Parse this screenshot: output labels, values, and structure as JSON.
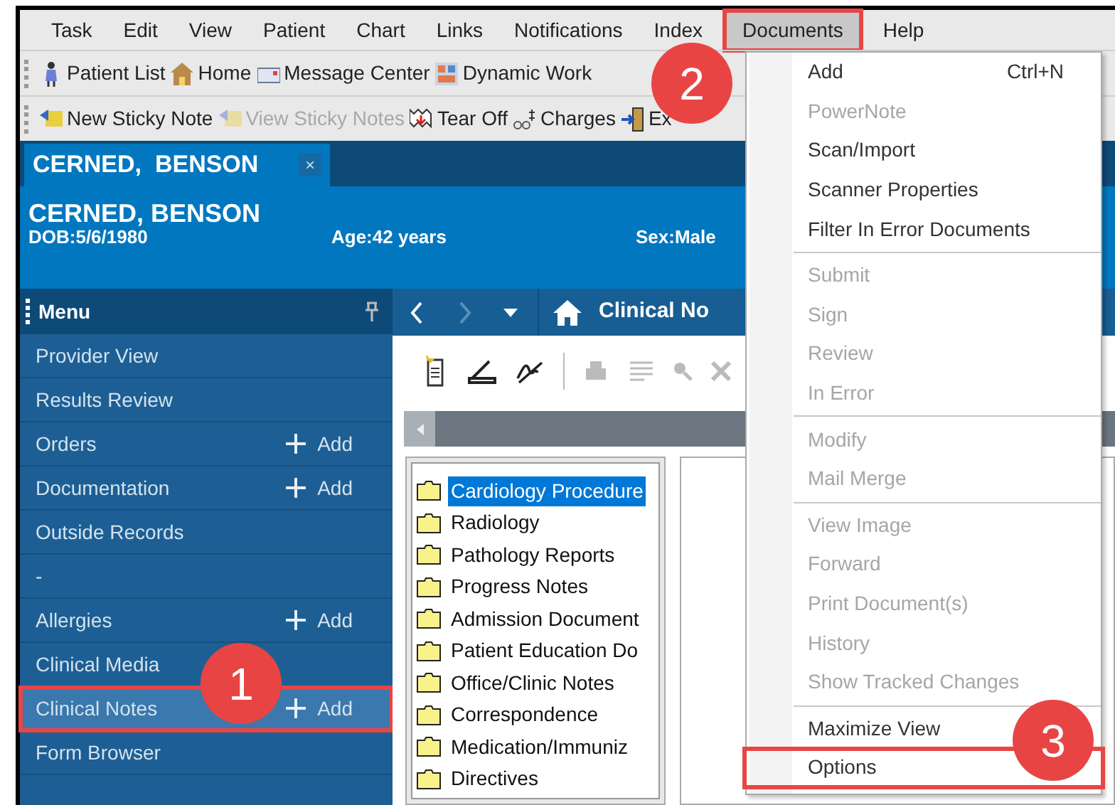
{
  "menu_bar": [
    {
      "label": "Task",
      "selected": false
    },
    {
      "label": "Edit",
      "selected": false
    },
    {
      "label": "View",
      "selected": false
    },
    {
      "label": "Patient",
      "selected": false
    },
    {
      "label": "Chart",
      "selected": false
    },
    {
      "label": "Links",
      "selected": false
    },
    {
      "label": "Notifications",
      "selected": false
    },
    {
      "label": "Index",
      "selected": false
    },
    {
      "label": "Documents",
      "selected": true
    },
    {
      "label": "Help",
      "selected": false
    }
  ],
  "toolbar_1": [
    {
      "label": "Patient List",
      "disabled": false
    },
    {
      "label": "Home",
      "disabled": false
    },
    {
      "label": "Message Center",
      "disabled": false
    },
    {
      "label": "Dynamic Work",
      "disabled": false
    }
  ],
  "toolbar_2": [
    {
      "label": "New Sticky Note",
      "disabled": false
    },
    {
      "label": "View Sticky Notes",
      "disabled": true
    },
    {
      "label": "Tear Off",
      "disabled": false
    },
    {
      "label": "Charges",
      "disabled": false
    },
    {
      "label": "Ex",
      "disabled": false
    }
  ],
  "patient_tab": {
    "label": "CERNED,  BENSON",
    "close": "×"
  },
  "banner": {
    "name": "CERNED, BENSON",
    "dob": "DOB:5/6/1980",
    "age": "Age:42 years",
    "sex": "Sex:Male"
  },
  "sidebar": {
    "title": "Menu",
    "items": [
      {
        "label": "Provider View",
        "selected": false
      },
      {
        "label": "Results Review",
        "selected": false
      },
      {
        "label": "Orders",
        "add": "Add",
        "selected": false
      },
      {
        "label": "Documentation",
        "add": "Add",
        "selected": false
      },
      {
        "label": "Outside Records",
        "selected": false
      },
      {
        "label": "-",
        "selected": false
      },
      {
        "label": "Allergies",
        "add": "Add",
        "selected": false
      },
      {
        "label": "Clinical Media",
        "selected": false
      },
      {
        "label": "Clinical Notes",
        "add": "Add",
        "selected": true
      },
      {
        "label": "Form Browser",
        "selected": false
      }
    ]
  },
  "nav": {
    "title": "Clinical No"
  },
  "folders": [
    {
      "label": "Cardiology Procedure",
      "selected": true
    },
    {
      "label": "Radiology",
      "selected": false
    },
    {
      "label": "Pathology Reports",
      "selected": false
    },
    {
      "label": "Progress Notes",
      "selected": false
    },
    {
      "label": "Admission Document",
      "selected": false
    },
    {
      "label": "Patient Education Do",
      "selected": false
    },
    {
      "label": "Office/Clinic Notes",
      "selected": false
    },
    {
      "label": "Correspondence",
      "selected": false
    },
    {
      "label": "Medication/Immuniz",
      "selected": false
    },
    {
      "label": "Directives",
      "selected": false
    }
  ],
  "documents_menu": [
    [
      {
        "label": "Add",
        "shortcut": "Ctrl+N",
        "disabled": false,
        "selected": false
      },
      {
        "label": "PowerNote",
        "disabled": true,
        "selected": false
      },
      {
        "label": "Scan/Import",
        "disabled": false,
        "selected": false
      },
      {
        "label": "Scanner Properties",
        "disabled": false,
        "selected": false
      },
      {
        "label": "Filter In Error Documents",
        "disabled": false,
        "selected": false
      }
    ],
    [
      {
        "label": "Submit",
        "disabled": true,
        "selected": false
      },
      {
        "label": "Sign",
        "disabled": true,
        "selected": false
      },
      {
        "label": "Review",
        "disabled": true,
        "selected": false
      },
      {
        "label": "In Error",
        "disabled": true,
        "selected": false
      }
    ],
    [
      {
        "label": "Modify",
        "disabled": true,
        "selected": false
      },
      {
        "label": "Mail Merge",
        "disabled": true,
        "selected": false
      }
    ],
    [
      {
        "label": "View Image",
        "disabled": true,
        "selected": false
      },
      {
        "label": "Forward",
        "disabled": true,
        "selected": false
      },
      {
        "label": "Print Document(s)",
        "disabled": true,
        "selected": false
      },
      {
        "label": "History",
        "disabled": true,
        "selected": false
      },
      {
        "label": "Show Tracked Changes",
        "disabled": true,
        "selected": false
      }
    ],
    [
      {
        "label": "Maximize View",
        "disabled": false,
        "selected": false
      },
      {
        "label": "Options",
        "disabled": false,
        "selected": true
      }
    ]
  ],
  "callouts": [
    "1",
    "2",
    "3"
  ]
}
